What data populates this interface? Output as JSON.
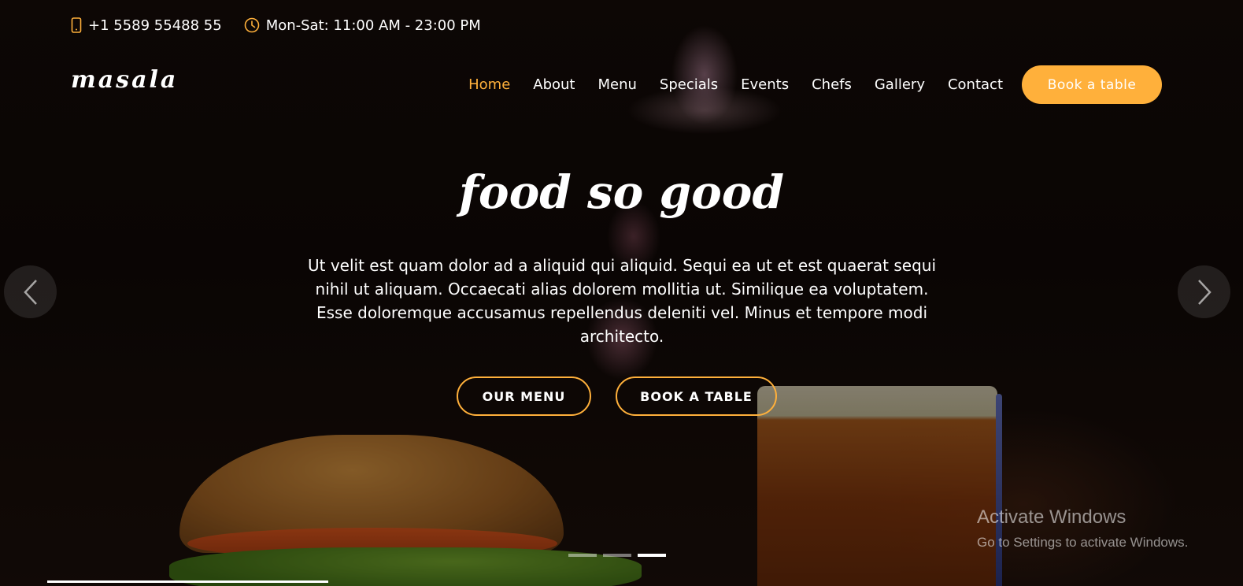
{
  "topbar": {
    "phone": "+1 5589 55488 55",
    "hours": "Mon-Sat: 11:00 AM - 23:00 PM",
    "icon_color": "#ffb03b"
  },
  "header": {
    "logo": "masala",
    "nav": [
      {
        "label": "Home",
        "active": true
      },
      {
        "label": "About"
      },
      {
        "label": "Menu"
      },
      {
        "label": "Specials"
      },
      {
        "label": "Events"
      },
      {
        "label": "Chefs"
      },
      {
        "label": "Gallery"
      },
      {
        "label": "Contact"
      }
    ],
    "book_button": "Book a table"
  },
  "hero": {
    "title": "food so good",
    "text": "Ut velit est quam dolor ad a aliquid qui aliquid. Sequi ea ut et est quaerat sequi nihil ut aliquam. Occaecati alias dolorem mollitia ut. Similique ea voluptatem. Esse doloremque accusamus repellendus deleniti vel. Minus et tempore modi architecto.",
    "buttons": {
      "menu": "OUR MENU",
      "book": "BOOK A TABLE"
    },
    "carousel": {
      "slide_count": 3,
      "active_slide": 3
    }
  },
  "watermark": {
    "title": "Activate Windows",
    "subtitle": "Go to Settings to activate Windows."
  },
  "colors": {
    "accent": "#ffb03b",
    "text": "#ffffff"
  }
}
